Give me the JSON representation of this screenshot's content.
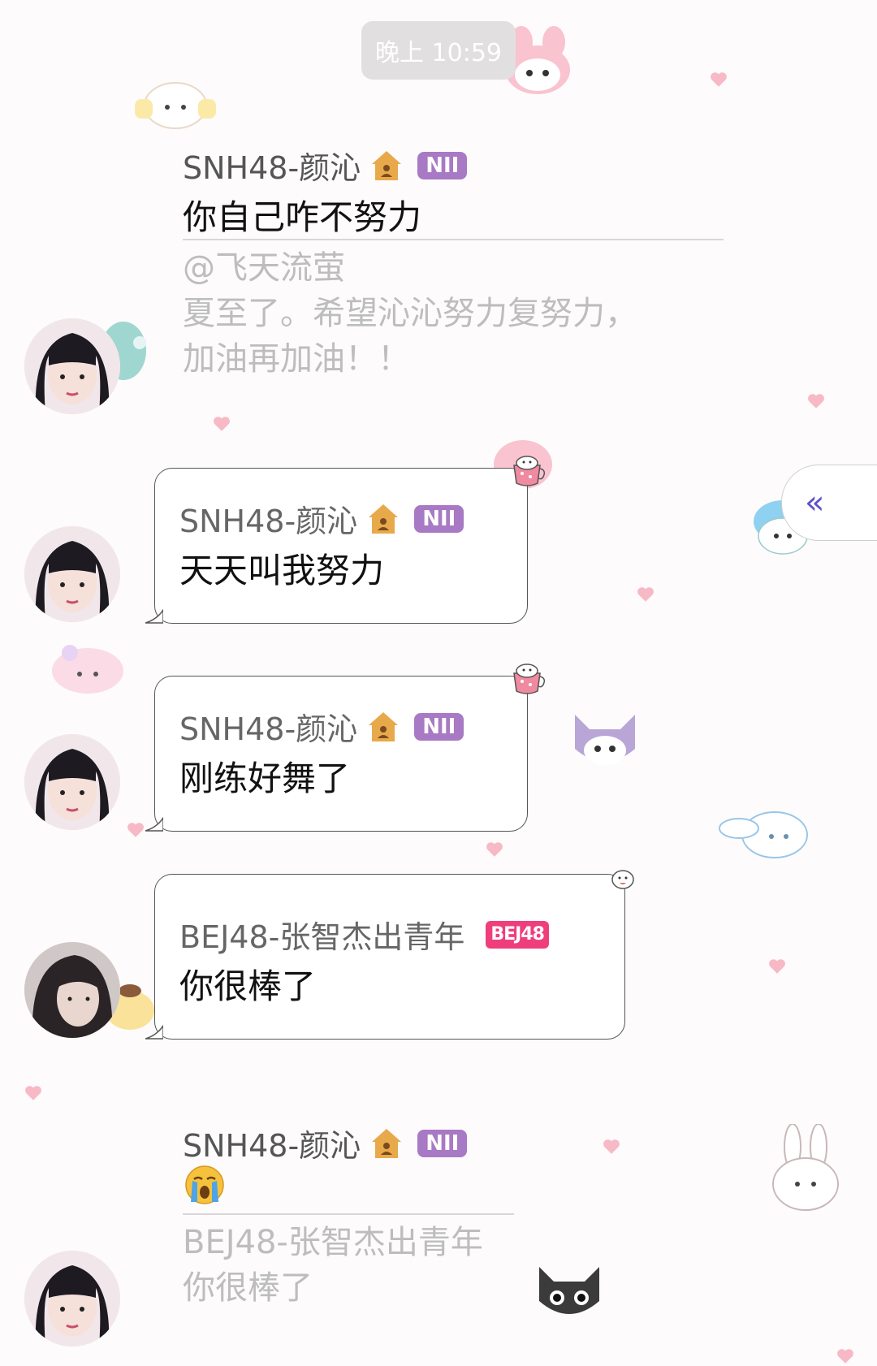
{
  "timestamp": "晚上 10:59",
  "messages": [
    {
      "sender": "SNH48-颜沁",
      "team_badge": "NII",
      "text": "你自己咋不努力",
      "reply_to": {
        "author": "@飞天流萤",
        "text_line1": "夏至了。希望沁沁努力复努力，",
        "text_line2": "加油再加油！！"
      }
    },
    {
      "sender": "SNH48-颜沁",
      "team_badge": "NII",
      "text": "天天叫我努力"
    },
    {
      "sender": "SNH48-颜沁",
      "team_badge": "NII",
      "text": "刚练好舞了"
    },
    {
      "sender": "BEJ48-张智杰出青年",
      "team_badge": "BEJ48",
      "text": "你很棒了"
    },
    {
      "sender": "SNH48-颜沁",
      "team_badge": "NII",
      "emoji": "crying-face-icon",
      "reply_to": {
        "author": "BEJ48-张智杰出青年",
        "text_line1": "你很棒了"
      }
    }
  ],
  "side_button": {
    "label": "«"
  },
  "colors": {
    "background": "#fdfbfc",
    "team_badge_nii": "#a879c4",
    "team_badge_bej": "#ee3e7b",
    "quote_text": "#bdbdbd",
    "time_pill": "#e1dfe0",
    "collapse_arrow": "#5b55c9"
  }
}
